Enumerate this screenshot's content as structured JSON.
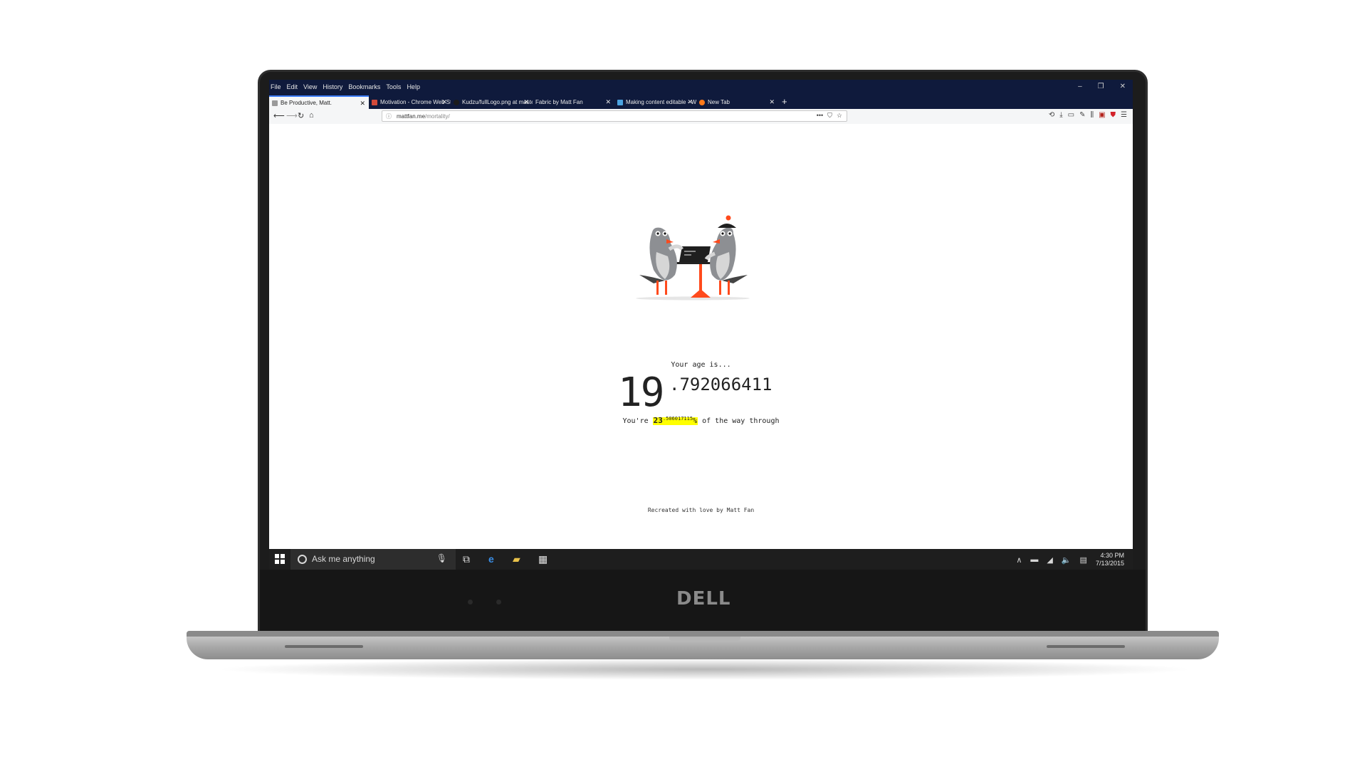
{
  "device": {
    "brand": "DELL"
  },
  "browser": {
    "menu": [
      "File",
      "Edit",
      "View",
      "History",
      "Bookmarks",
      "Tools",
      "Help"
    ],
    "window_controls": [
      "–",
      "❐",
      "✕"
    ],
    "tabs": [
      {
        "title": "Be Productive, Matt.",
        "active": true,
        "favicon_color": "#9a9a9a"
      },
      {
        "title": "Motivation - Chrome Web Sto",
        "active": false,
        "favicon_color": "#d34a3a"
      },
      {
        "title": "Kudzu/fullLogo.png at master",
        "active": false,
        "favicon_color": "#1b1b1b"
      },
      {
        "title": "Fabric by Matt Fan",
        "active": false,
        "favicon_color": "#0f1a3c"
      },
      {
        "title": "Making content editable - Wel",
        "active": false,
        "favicon_color": "#4ba3e0"
      },
      {
        "title": "New Tab",
        "active": false,
        "favicon_color": "#ff7a1a"
      }
    ],
    "new_tab_label": "+",
    "url_domain": "mattfan.me",
    "url_path": "/mortality/",
    "url_actions": [
      "•••",
      "⛉",
      "☆"
    ]
  },
  "page": {
    "age_label": "Your age is...",
    "age_integer": "19",
    "age_decimal": ".792066411",
    "pct_prefix": "You're",
    "pct_integer": "23",
    "pct_decimal": ".506017115",
    "pct_symbol": "%",
    "pct_suffix": "of the way through",
    "footer": "Recreated with love by Matt Fan"
  },
  "taskbar": {
    "search_placeholder": "Ask me anything",
    "time": "4:30 PM",
    "date": "7/13/2015"
  },
  "colors": {
    "highlight": "#ffff00",
    "title_bar": "#0f1a3c",
    "accent": "#ff4a1c"
  }
}
